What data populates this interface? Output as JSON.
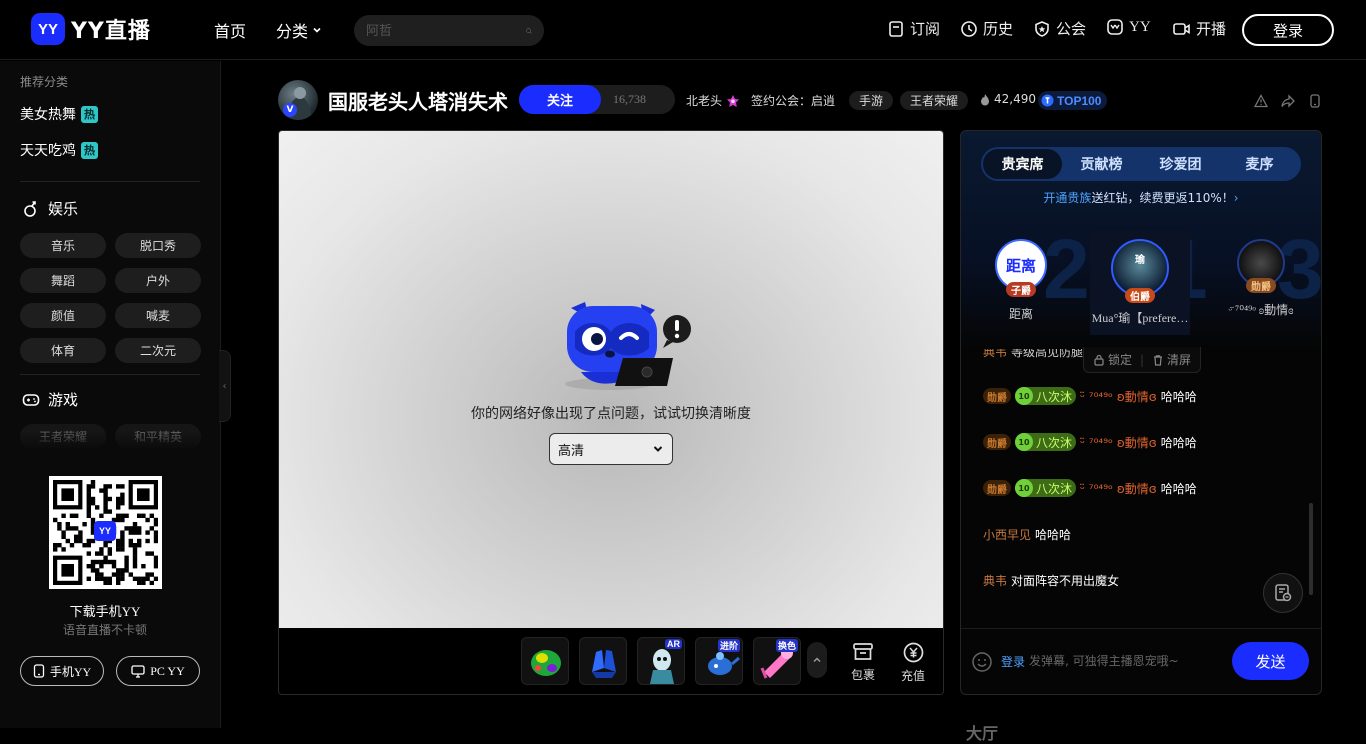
{
  "brand": {
    "logo_text": "YY直播",
    "badge": "YY",
    "color": "#1b2cff"
  },
  "nav": {
    "home": "首页",
    "category": "分类",
    "search_placeholder": "阿哲",
    "subscribe": "订阅",
    "history": "历史",
    "guild": "公会",
    "yy": "YY",
    "broadcast": "开播",
    "login": "登录"
  },
  "sidebar": {
    "recommend_title": "推荐分类",
    "hot_items": [
      {
        "label": "美女热舞",
        "badge": "热"
      },
      {
        "label": "天天吃鸡",
        "badge": "热"
      }
    ],
    "entertainment": {
      "title": "娱乐",
      "chips": [
        "音乐",
        "脱口秀",
        "舞蹈",
        "户外",
        "颜值",
        "喊麦",
        "体育",
        "二次元"
      ]
    },
    "games": {
      "title": "游戏",
      "chips": [
        "王者荣耀",
        "和平精英"
      ]
    },
    "qr_badge": "YY",
    "download_title": "下载手机YY",
    "download_subtitle": "语音直播不卡顿",
    "mobile_btn": "手机YY",
    "pc_btn": "PC YY"
  },
  "room": {
    "title": "国服老头人塔消失术",
    "avatar_badge": "V",
    "follow_label": "关注",
    "follow_count": "16,738",
    "host_name": "北老头",
    "guild": "签约公会：启逍",
    "tags": [
      "手游",
      "王者荣耀"
    ],
    "heat": "42,490",
    "rank_badge": "TOP100"
  },
  "player": {
    "error_message": "你的网络好像出现了点问题，试试切换清晰度",
    "quality": "高清",
    "gift_tags": [
      "AR",
      "进阶",
      "换色"
    ],
    "package_label": "包裹",
    "recharge_label": "充值"
  },
  "panel": {
    "tabs": [
      "贵宾席",
      "贡献榜",
      "珍爱团",
      "麦序"
    ],
    "promo_link": "开通贵族",
    "promo_text": "送红钻，续费更返110%！",
    "rank_numbers": [
      "2",
      "1",
      "3"
    ],
    "vips": [
      {
        "name": "距离",
        "rank": "子爵",
        "avatar_text": "距离"
      },
      {
        "name": "Mua°瑜【prefere…",
        "rank": "伯爵",
        "avatar_text": "瑜"
      },
      {
        "name": "ᵕ̈ ⁷⁰⁴⁹ᵒ ʚ動情ɞ",
        "rank": "勋爵",
        "avatar_text": ""
      }
    ],
    "lock_label": "锁定",
    "clear_label": "清屏",
    "messages": [
      {
        "level": "勋爵",
        "fan": "八次沐",
        "fan_level": "10",
        "user": "ᵕ̈ ⁷⁰⁴⁹ᵒ ʚ動情ɞ",
        "text": "哈哈哈"
      },
      {
        "level": "勋爵",
        "fan": "八次沐",
        "fan_level": "10",
        "user": "ᵕ̈ ⁷⁰⁴⁹ᵒ ʚ動情ɞ",
        "text": "哈哈哈"
      },
      {
        "level": "勋爵",
        "fan": "八次沐",
        "fan_level": "10",
        "user": "ᵕ̈ ⁷⁰⁴⁹ᵒ ʚ動情ɞ",
        "text": "哈哈哈"
      },
      {
        "user": "小西早见",
        "text": "哈哈哈"
      },
      {
        "user": "典韦",
        "text": "对面阵容不用出魔女"
      }
    ],
    "partial_message": {
      "user": "典韦",
      "text": "等级高见防腿"
    },
    "chat_login": "登录",
    "chat_placeholder": "发弹幕, 可独得主播恩宠哦~",
    "send_label": "发送"
  },
  "below": {
    "section_peek": "大厅"
  }
}
